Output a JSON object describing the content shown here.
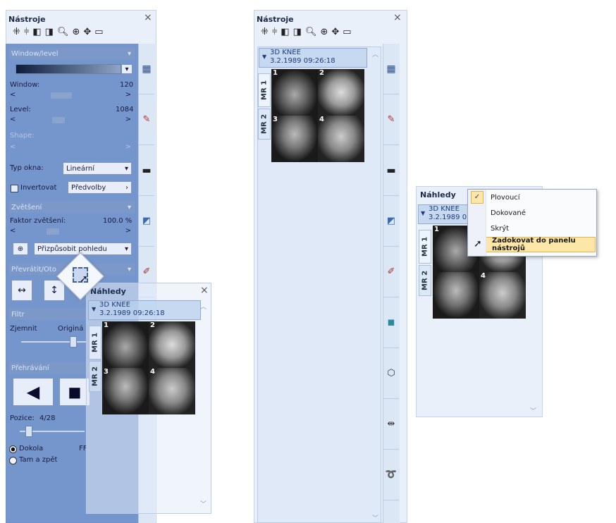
{
  "panel1": {
    "title": "Nástroje",
    "close": "×",
    "sections": {
      "window_level": "Window/level",
      "zoom": "Zvětšení",
      "flip": "Převrátit/Oto",
      "filter": "Filtr",
      "playback": "Přehrávání"
    },
    "window_label": "Window:",
    "window_value": "120",
    "level_label": "Level:",
    "level_value": "1084",
    "shape_label": "Shape:",
    "window_type_label": "Typ okna:",
    "window_type_value": "Lineární",
    "invert_label": "Invertovat",
    "presets_label": "Předvolby",
    "zoom_factor_label": "Faktor zvětšení:",
    "zoom_factor_value": "100.0 %",
    "fit_label": "Přizpůsobit pohledu",
    "filter_smooth": "Zjemnit",
    "filter_original": "Originá",
    "position_label": "Pozice:",
    "position_value": "4/28",
    "loop_label": "Dokola",
    "bounce_label": "Tam a zpět",
    "fps_label": "FF"
  },
  "floating": {
    "title": "Náhledy",
    "close": "×",
    "study": "3D KNEE",
    "date": "3.2.1989 09:26:18",
    "tabs": [
      "MR 1",
      "MR 2"
    ],
    "thumbs": [
      "1",
      "2",
      "3",
      "4"
    ]
  },
  "panel2": {
    "title": "Nástroje",
    "close": "×",
    "study": "3D KNEE",
    "date": "3.2.1989 09:26:18",
    "tabs": [
      "MR 1",
      "MR 2"
    ],
    "thumbs": [
      "1",
      "2",
      "3",
      "4"
    ]
  },
  "panel3": {
    "title": "Náhledy",
    "study": "3D KNEE",
    "date": "3.2.1989 0",
    "tabs": [
      "MR 1",
      "MR 2"
    ],
    "thumbs": [
      "1",
      "4"
    ],
    "menu": [
      "Plovoucí",
      "Dokované",
      "Skrýt",
      "Zadokovat do panelu nástrojů"
    ]
  }
}
